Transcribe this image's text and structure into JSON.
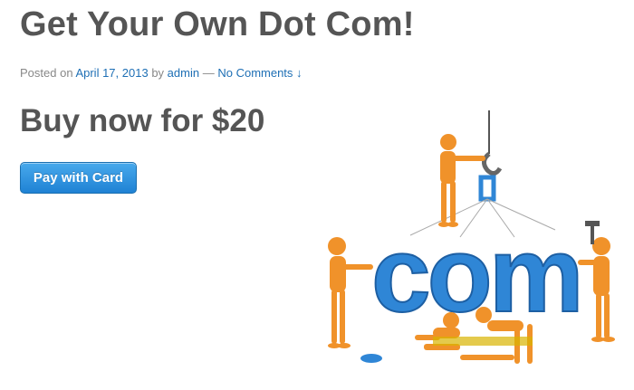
{
  "post": {
    "title": "Get Your Own Dot Com!",
    "meta": {
      "posted_on": "Posted on",
      "date": "April 17, 2013",
      "by": "by",
      "author": "admin",
      "separator": "—",
      "comments": "No Comments ↓"
    },
    "subheading": "Buy now for $20",
    "pay_button": "Pay with Card",
    "illustration": {
      "text": "com",
      "colors": {
        "letters": "#2f86d6",
        "figures": "#f0922a",
        "crane": "#555555"
      }
    }
  }
}
